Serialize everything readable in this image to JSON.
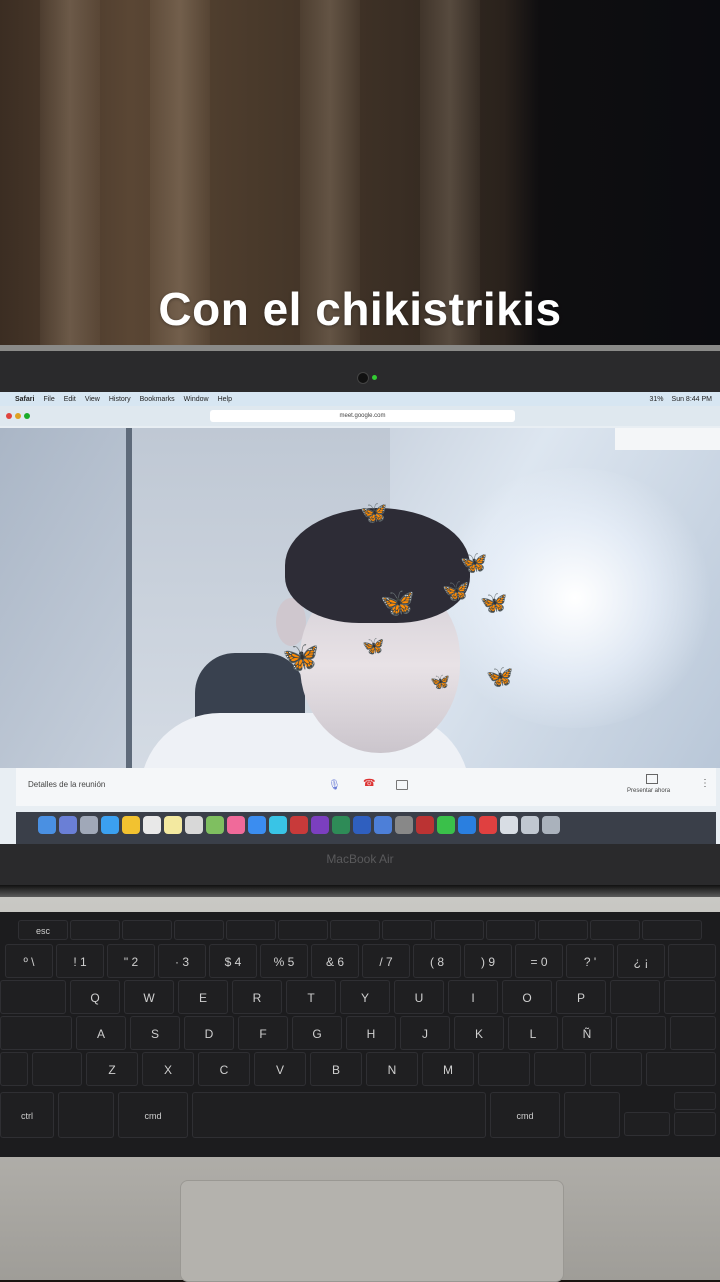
{
  "caption": "Con el chikistrikis",
  "menubar": {
    "apple": "",
    "app": "Safari",
    "items": [
      "File",
      "Edit",
      "View",
      "History",
      "Bookmarks",
      "Window",
      "Help"
    ],
    "battery": "31%",
    "clock": "Sun 8:44 PM"
  },
  "browser": {
    "url": "meet.google.com"
  },
  "meet": {
    "details": "Detalles de la reunión",
    "present": "Presentar ahora"
  },
  "laptop": {
    "brand": "MacBook Air"
  },
  "keyboard": {
    "row_num": [
      "º\n\\",
      "!\n1",
      "\"\n2",
      "·\n3",
      "$\n4",
      "%\n5",
      "&\n6",
      "/\n7",
      "(\n8",
      ")\n9",
      "=\n0",
      "?\n'",
      "¿\n¡"
    ],
    "row_q": [
      "Q",
      "W",
      "E",
      "R",
      "T",
      "Y",
      "U",
      "I",
      "O",
      "P"
    ],
    "row_a": [
      "A",
      "S",
      "D",
      "F",
      "G",
      "H",
      "J",
      "K",
      "L",
      "Ñ"
    ],
    "row_z": [
      "Z",
      "X",
      "C",
      "V",
      "B",
      "N",
      "M"
    ],
    "cmd_left": "cmd",
    "cmd_right": "cmd",
    "ctrl": "ctrl",
    "esc": "esc"
  },
  "colors": {
    "caption": "#ffffff",
    "menubar": "#d7e6f2",
    "keyboard": "#1c1c1e"
  }
}
